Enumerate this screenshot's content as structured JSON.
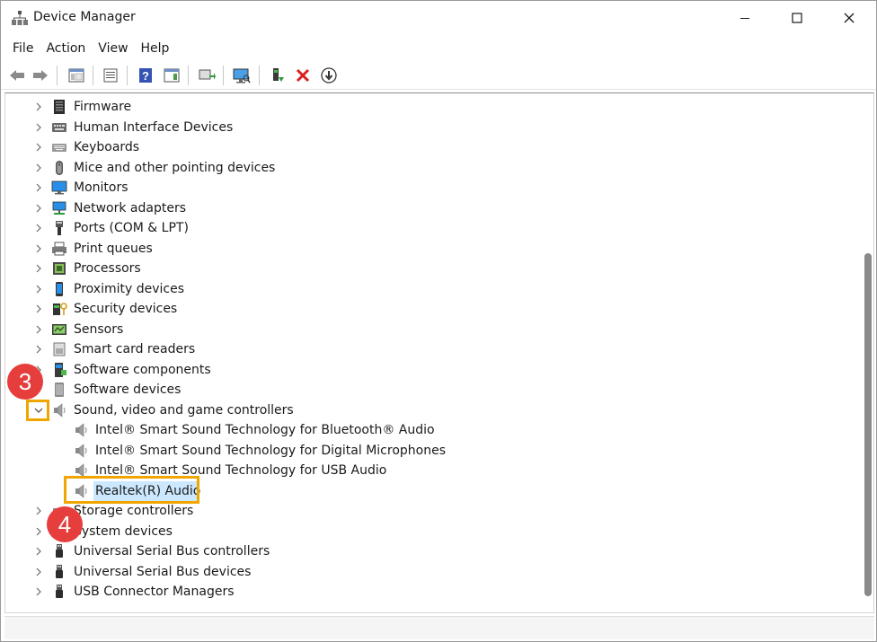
{
  "window": {
    "title": "Device Manager",
    "controls": {
      "minimize": "minimize",
      "maximize": "maximize",
      "close": "close"
    }
  },
  "menu": [
    "File",
    "Action",
    "View",
    "Help"
  ],
  "toolbar": [
    "back-icon",
    "forward-icon",
    "show-hide-console-tree-icon",
    "properties-icon",
    "help-icon",
    "action-pane-icon",
    "update-driver-icon",
    "scan-hardware-icon",
    "enable-device-icon",
    "uninstall-device-icon",
    "disable-device-icon"
  ],
  "tree": {
    "items": [
      {
        "label": "Firmware",
        "icon": "firmware-icon",
        "expanded": false
      },
      {
        "label": "Human Interface Devices",
        "icon": "hid-icon",
        "expanded": false
      },
      {
        "label": "Keyboards",
        "icon": "keyboard-icon",
        "expanded": false
      },
      {
        "label": "Mice and other pointing devices",
        "icon": "mouse-icon",
        "expanded": false
      },
      {
        "label": "Monitors",
        "icon": "monitor-icon",
        "expanded": false
      },
      {
        "label": "Network adapters",
        "icon": "network-icon",
        "expanded": false
      },
      {
        "label": "Ports (COM & LPT)",
        "icon": "port-icon",
        "expanded": false
      },
      {
        "label": "Print queues",
        "icon": "printer-icon",
        "expanded": false
      },
      {
        "label": "Processors",
        "icon": "processor-icon",
        "expanded": false
      },
      {
        "label": "Proximity devices",
        "icon": "proximity-icon",
        "expanded": false
      },
      {
        "label": "Security devices",
        "icon": "security-icon",
        "expanded": false
      },
      {
        "label": "Sensors",
        "icon": "sensor-icon",
        "expanded": false
      },
      {
        "label": "Smart card readers",
        "icon": "smartcard-icon",
        "expanded": false
      },
      {
        "label": "Software components",
        "icon": "software-component-icon",
        "expanded": false
      },
      {
        "label": "Software devices",
        "icon": "software-device-icon",
        "expanded": false
      },
      {
        "label": "Sound, video and game controllers",
        "icon": "speaker-icon",
        "expanded": true
      },
      {
        "label": "Storage controllers",
        "icon": "storage-icon",
        "expanded": false
      },
      {
        "label": "System devices",
        "icon": "system-icon",
        "expanded": false
      },
      {
        "label": "Universal Serial Bus controllers",
        "icon": "usb-icon",
        "expanded": false
      },
      {
        "label": "Universal Serial Bus devices",
        "icon": "usb-icon",
        "expanded": false
      },
      {
        "label": "USB Connector Managers",
        "icon": "usb-icon",
        "expanded": false
      }
    ],
    "sound_children": [
      {
        "label": "Intel® Smart Sound Technology for Bluetooth® Audio",
        "icon": "speaker-icon"
      },
      {
        "label": "Intel® Smart Sound Technology for Digital Microphones",
        "icon": "speaker-icon"
      },
      {
        "label": "Intel® Smart Sound Technology for USB Audio",
        "icon": "speaker-icon"
      },
      {
        "label": "Realtek(R) Audio",
        "icon": "speaker-icon",
        "selected": true
      }
    ]
  },
  "annotations": {
    "step_3": "3",
    "step_4": "4"
  },
  "colors": {
    "highlight": "#f0a500",
    "badge": "#e63d3d",
    "selection": "#cce8ff"
  }
}
